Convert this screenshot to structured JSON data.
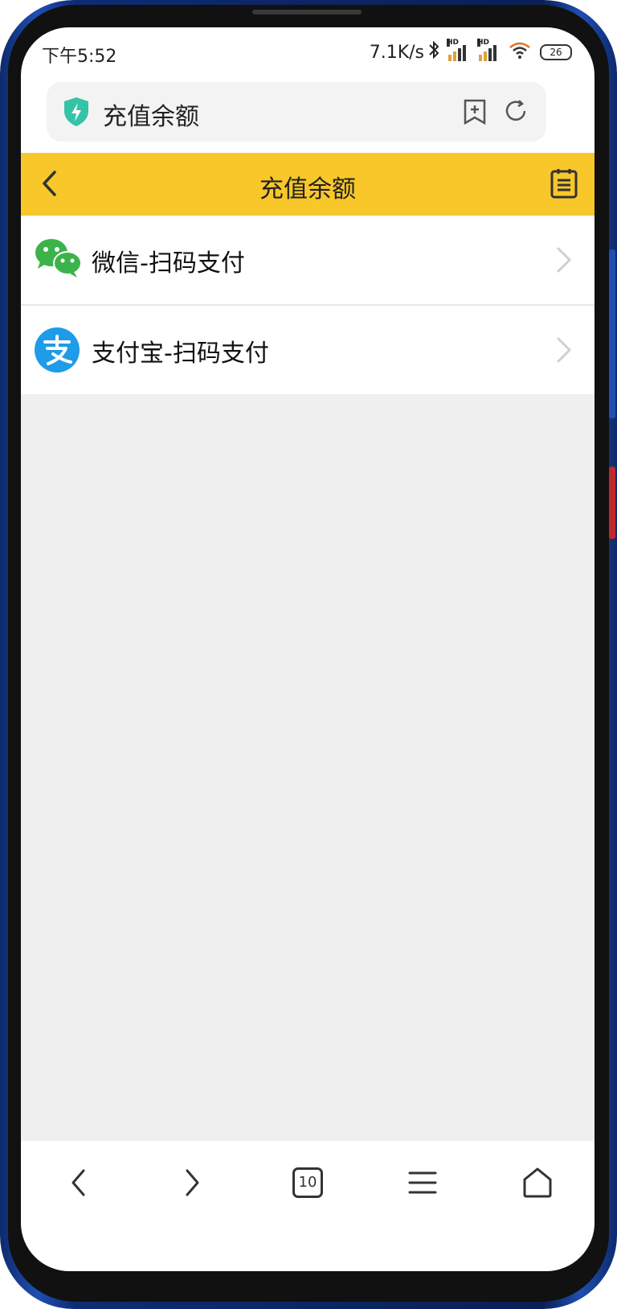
{
  "status_bar": {
    "time": "下午5:52",
    "network_speed": "7.1K/s",
    "signal_1_label": "HD",
    "signal_2_label": "HD",
    "battery": "26"
  },
  "browser": {
    "address_text": "充值余额",
    "tabs_count": "10"
  },
  "header": {
    "title": "充值余额",
    "accent_color": "#f8c72a"
  },
  "payment_options": [
    {
      "label": "微信-扫码支付",
      "icon": "wechat-icon",
      "color": "#3bb34a"
    },
    {
      "label": "支付宝-扫码支付",
      "icon": "alipay-icon",
      "color": "#1e9be9"
    }
  ],
  "bottom_nav": {
    "items": [
      "back-icon",
      "forward-icon",
      "tabs-icon",
      "menu-icon",
      "home-icon"
    ]
  }
}
